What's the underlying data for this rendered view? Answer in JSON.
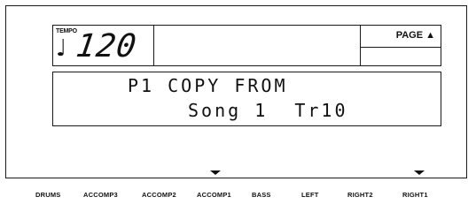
{
  "tempo": {
    "label": "TEMPO",
    "value": "120",
    "note_icon": "quarter-note-icon"
  },
  "page": {
    "label": "PAGE ▲"
  },
  "display": {
    "line1": "P1 COPY FROM",
    "line2": "Song 1  Tr10"
  },
  "indicators": [
    "ACCOMP1",
    "RIGHT1"
  ],
  "parts": [
    "DRUMS",
    "ACCOMP3",
    "ACCOMP2",
    "ACCOMP1",
    "BASS",
    "LEFT",
    "RIGHT2",
    "RIGHT1"
  ]
}
